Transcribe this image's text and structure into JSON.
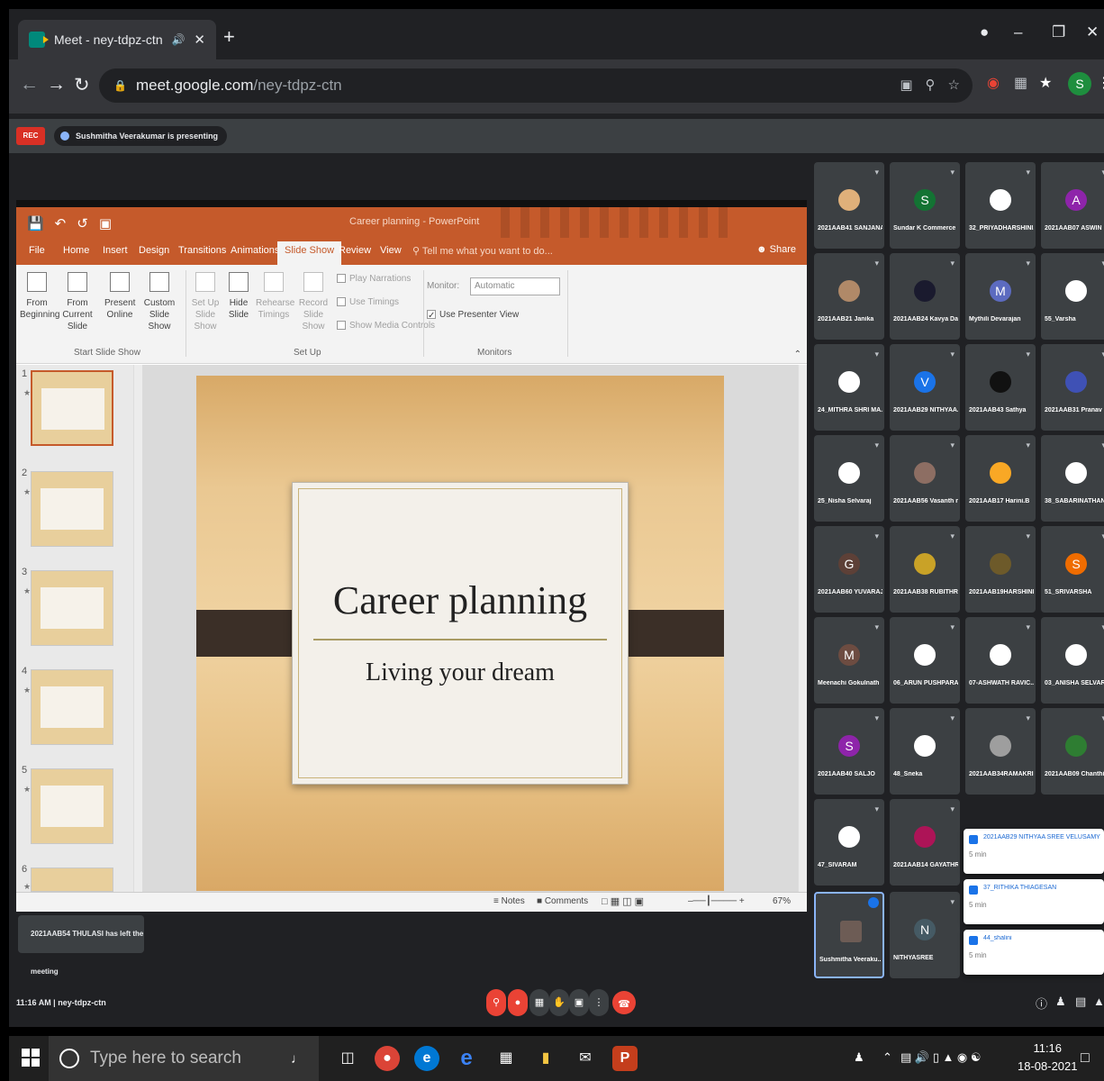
{
  "browser": {
    "tab_title": "Meet - ney-tdpz-ctn",
    "url_host": "meet.google.com",
    "url_path": "/ney-tdpz-ctn",
    "profile_initial": "S"
  },
  "meet": {
    "rec_label": "REC",
    "presenting_text": "Sushmitha Veerakumar is presenting",
    "meeting_info": "11:16 AM | ney-tdpz-ctn",
    "toast": "2021AAB54 THULASI has left the meeting"
  },
  "powerpoint": {
    "title": "Career planning - PowerPoint",
    "tabs": [
      "File",
      "Home",
      "Insert",
      "Design",
      "Transitions",
      "Animations",
      "Slide Show",
      "Review",
      "View"
    ],
    "active_tab": "Slide Show",
    "tell_me": "Tell me what you want to do...",
    "share": "Share",
    "ribbon": {
      "from_beginning": "From Beginning",
      "from_current": "From Current Slide",
      "present_online": "Present Online",
      "custom_show": "Custom Slide Show",
      "set_up": "Set Up Slide Show",
      "hide_slide": "Hide Slide",
      "rehearse": "Rehearse Timings",
      "record": "Record Slide Show",
      "play_narrations": "Play Narrations",
      "use_timings": "Use Timings",
      "show_media": "Show Media Controls",
      "monitor_label": "Monitor:",
      "monitor_value": "Automatic",
      "presenter_view": "Use Presenter View",
      "group_start": "Start Slide Show",
      "group_setup": "Set Up",
      "group_monitors": "Monitors"
    },
    "slide_numbers": [
      "1",
      "2",
      "3",
      "4",
      "5",
      "6"
    ],
    "slide": {
      "title": "Career planning",
      "subtitle": "Living your dream"
    },
    "status": {
      "notes": "Notes",
      "comments": "Comments",
      "zoom": "67%"
    }
  },
  "participants": [
    {
      "name": "2021AAB41 SANJANA",
      "initial": "",
      "color": "#e0b07a"
    },
    {
      "name": "Sundar K Commerce",
      "initial": "S",
      "color": "#137333"
    },
    {
      "name": "32_PRIYADHARSHINI...",
      "initial": "",
      "color": "#ffffff"
    },
    {
      "name": "2021AAB07 ASWIN",
      "initial": "A",
      "color": "#8e24aa"
    },
    {
      "name": "2021AAB21 Janika",
      "initial": "",
      "color": "#b08968"
    },
    {
      "name": "2021AAB24 Kavya Da...",
      "initial": "",
      "color": "#1a1a2e"
    },
    {
      "name": "Mythili Devarajan",
      "initial": "M",
      "color": "#5c6bc0"
    },
    {
      "name": "55_Varsha",
      "initial": "",
      "color": "#ffffff"
    },
    {
      "name": "24_MITHRA SHRI MA...",
      "initial": "",
      "color": "#ffffff"
    },
    {
      "name": "2021AAB29 NITHYAA...",
      "initial": "V",
      "color": "#1a73e8"
    },
    {
      "name": "2021AAB43 Sathya",
      "initial": "",
      "color": "#111111"
    },
    {
      "name": "2021AAB31 Pranav",
      "initial": "",
      "color": "#3f51b5"
    },
    {
      "name": "25_Nisha Selvaraj",
      "initial": "",
      "color": "#ffffff"
    },
    {
      "name": "2021AAB56 Vasanth r...",
      "initial": "",
      "color": "#8d6e63"
    },
    {
      "name": "2021AAB17 Harini.B",
      "initial": "",
      "color": "#f9a825"
    },
    {
      "name": "38_SABARINATHAN...",
      "initial": "",
      "color": "#ffffff"
    },
    {
      "name": "2021AAB60 YUVARAJ...",
      "initial": "G",
      "color": "#5d4037"
    },
    {
      "name": "2021AAB38 RUBITHR...",
      "initial": "",
      "color": "#c9a227"
    },
    {
      "name": "2021AAB19HARSHINI...",
      "initial": "",
      "color": "#6d5a2a"
    },
    {
      "name": "51_SRIVARSHA",
      "initial": "S",
      "color": "#ef6c00"
    },
    {
      "name": "Meenachi Gokulnath",
      "initial": "M",
      "color": "#6d4c41"
    },
    {
      "name": "06_ARUN PUSHPARAJ",
      "initial": "",
      "color": "#ffffff"
    },
    {
      "name": "07-ASHWATH RAVIC...",
      "initial": "",
      "color": "#ffffff"
    },
    {
      "name": "03_ANISHA SELVARAJ",
      "initial": "",
      "color": "#ffffff"
    },
    {
      "name": "2021AAB40 SALJO",
      "initial": "S",
      "color": "#8e24aa"
    },
    {
      "name": "48_Sneka",
      "initial": "",
      "color": "#ffffff"
    },
    {
      "name": "2021AAB34RAMAKRI...",
      "initial": "",
      "color": "#9e9e9e"
    },
    {
      "name": "2021AAB09 Chanthi...",
      "initial": "",
      "color": "#2e7d32"
    },
    {
      "name": "47_SIVARAM",
      "initial": "",
      "color": "#ffffff"
    },
    {
      "name": "2021AAB14 GAYATHR...",
      "initial": "",
      "color": "#ad1457"
    }
  ],
  "self_tile": {
    "name": "Sushmitha Veeraku..."
  },
  "nithyasree_tile": {
    "name": "NITHYASREE",
    "initial": "N"
  },
  "chat_popups": [
    {
      "title": "2021AAB29 NITHYAA SREE VELUSAMY",
      "sub": "5 min"
    },
    {
      "title": "37_RITHIKA THIAGESAN",
      "sub": "5 min"
    },
    {
      "title": "44_shalini",
      "sub": "5 min"
    }
  ],
  "taskbar": {
    "search_placeholder": "Type here to search",
    "time": "11:16",
    "date": "18-08-2021"
  }
}
